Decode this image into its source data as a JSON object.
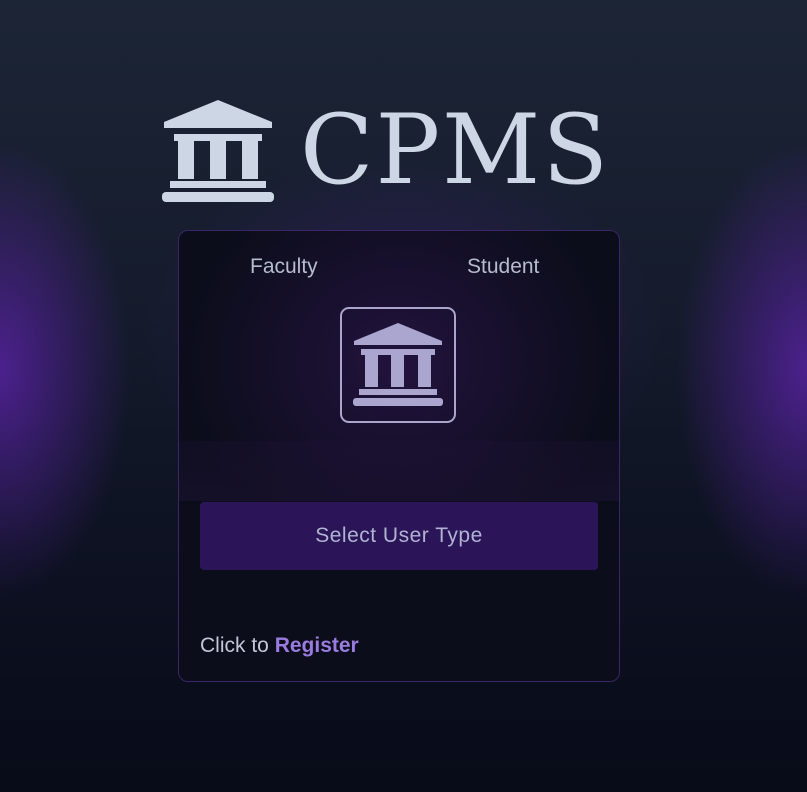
{
  "header": {
    "icon": "institution-icon",
    "title": "CPMS"
  },
  "card": {
    "tabs": [
      {
        "label": "Faculty"
      },
      {
        "label": "Student"
      }
    ],
    "user_type_icon": "institution-icon",
    "select_button_label": "Select User Type",
    "register": {
      "prefix": "Click to",
      "link_label": "Register"
    }
  },
  "colors": {
    "accent": "#2b1457",
    "link": "#9a7be0",
    "title": "#cdd6e4",
    "border": "#3a2566"
  }
}
